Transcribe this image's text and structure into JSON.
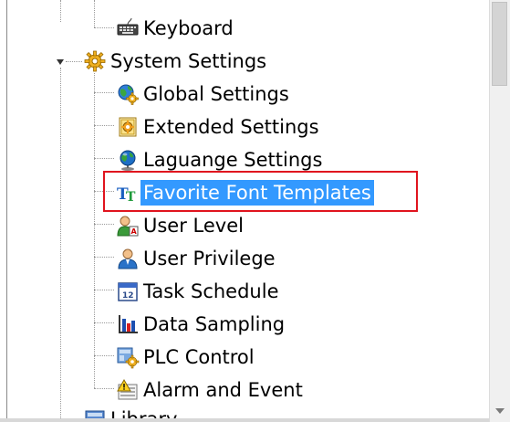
{
  "tree": {
    "items": [
      {
        "label": "Keyboard",
        "icon": "keyboard-icon"
      },
      {
        "label": "System Settings",
        "icon": "system-settings-gear-icon",
        "expanded": true
      },
      {
        "label": "Global Settings",
        "icon": "globe-settings-icon"
      },
      {
        "label": "Extended Settings",
        "icon": "extended-settings-icon"
      },
      {
        "label": "Laguange Settings",
        "icon": "language-globe-icon"
      },
      {
        "label": "Favorite Font Templates",
        "icon": "font-tt-icon",
        "selected": true
      },
      {
        "label": "User Level",
        "icon": "user-level-icon"
      },
      {
        "label": "User Privilege",
        "icon": "user-privilege-icon"
      },
      {
        "label": "Task Schedule",
        "icon": "calendar-icon"
      },
      {
        "label": "Data Sampling",
        "icon": "bar-chart-icon"
      },
      {
        "label": "PLC Control",
        "icon": "plc-control-icon"
      },
      {
        "label": "Alarm and Event",
        "icon": "alarm-warning-icon"
      },
      {
        "label": "Library",
        "icon": "library-icon"
      }
    ]
  },
  "colors": {
    "selection": "#3399ff",
    "highlight_border": "#e0141e"
  }
}
